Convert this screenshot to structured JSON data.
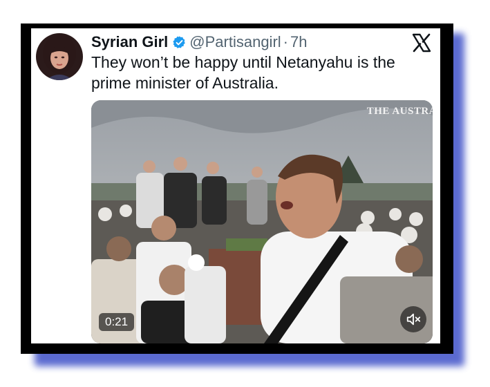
{
  "tweet": {
    "display_name": "Syrian Girl",
    "handle": "@Partisangirl",
    "separator": "·",
    "time": "7h",
    "text": "They won’t be happy until Netanyahu is the prime minister of Australia.",
    "verified_icon": "verified-badge-icon",
    "platform_icon": "x-logo-icon"
  },
  "media": {
    "watermark": "THE AUSTRA",
    "duration": "0:21",
    "mute_icon": "speaker-muted-icon"
  },
  "colors": {
    "frame": "#000000",
    "shadow": "#3f51c8",
    "verified": "#1d9bf0",
    "secondary_text": "#536471"
  }
}
